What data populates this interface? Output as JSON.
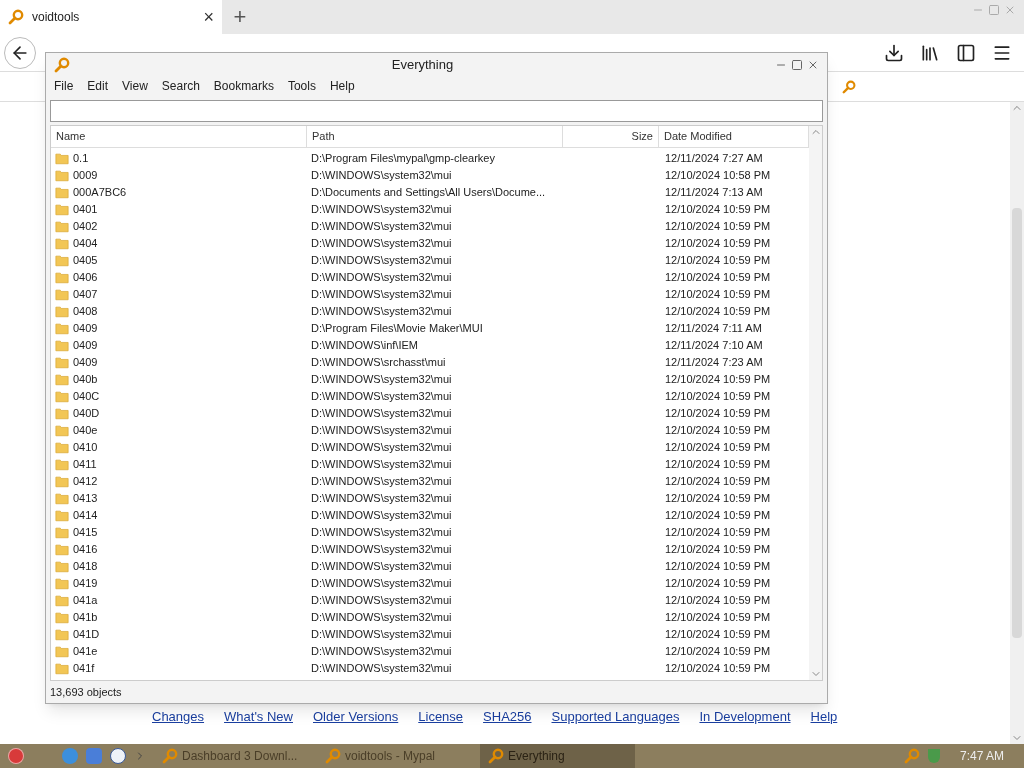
{
  "browser": {
    "tab": {
      "title": "voidtools",
      "close": "×"
    },
    "new_tab": "+"
  },
  "window": {
    "title": "Everything",
    "menu": [
      "File",
      "Edit",
      "View",
      "Search",
      "Bookmarks",
      "Tools",
      "Help"
    ],
    "table": {
      "columns": [
        "Name",
        "Path",
        "Size",
        "Date Modified"
      ],
      "rows": [
        {
          "name": "0.1",
          "path": "D:\\Program Files\\mypal\\gmp-clearkey",
          "date": "12/11/2024 7:27 AM"
        },
        {
          "name": "0009",
          "path": "D:\\WINDOWS\\system32\\mui",
          "date": "12/10/2024 10:58 PM"
        },
        {
          "name": "000A7BC6",
          "path": "D:\\Documents and Settings\\All Users\\Docume...",
          "date": "12/11/2024 7:13 AM"
        },
        {
          "name": "0401",
          "path": "D:\\WINDOWS\\system32\\mui",
          "date": "12/10/2024 10:59 PM"
        },
        {
          "name": "0402",
          "path": "D:\\WINDOWS\\system32\\mui",
          "date": "12/10/2024 10:59 PM"
        },
        {
          "name": "0404",
          "path": "D:\\WINDOWS\\system32\\mui",
          "date": "12/10/2024 10:59 PM"
        },
        {
          "name": "0405",
          "path": "D:\\WINDOWS\\system32\\mui",
          "date": "12/10/2024 10:59 PM"
        },
        {
          "name": "0406",
          "path": "D:\\WINDOWS\\system32\\mui",
          "date": "12/10/2024 10:59 PM"
        },
        {
          "name": "0407",
          "path": "D:\\WINDOWS\\system32\\mui",
          "date": "12/10/2024 10:59 PM"
        },
        {
          "name": "0408",
          "path": "D:\\WINDOWS\\system32\\mui",
          "date": "12/10/2024 10:59 PM"
        },
        {
          "name": "0409",
          "path": "D:\\Program Files\\Movie Maker\\MUI",
          "date": "12/11/2024 7:11 AM"
        },
        {
          "name": "0409",
          "path": "D:\\WINDOWS\\inf\\IEM",
          "date": "12/11/2024 7:10 AM"
        },
        {
          "name": "0409",
          "path": "D:\\WINDOWS\\srchasst\\mui",
          "date": "12/11/2024 7:23 AM"
        },
        {
          "name": "040b",
          "path": "D:\\WINDOWS\\system32\\mui",
          "date": "12/10/2024 10:59 PM"
        },
        {
          "name": "040C",
          "path": "D:\\WINDOWS\\system32\\mui",
          "date": "12/10/2024 10:59 PM"
        },
        {
          "name": "040D",
          "path": "D:\\WINDOWS\\system32\\mui",
          "date": "12/10/2024 10:59 PM"
        },
        {
          "name": "040e",
          "path": "D:\\WINDOWS\\system32\\mui",
          "date": "12/10/2024 10:59 PM"
        },
        {
          "name": "0410",
          "path": "D:\\WINDOWS\\system32\\mui",
          "date": "12/10/2024 10:59 PM"
        },
        {
          "name": "0411",
          "path": "D:\\WINDOWS\\system32\\mui",
          "date": "12/10/2024 10:59 PM"
        },
        {
          "name": "0412",
          "path": "D:\\WINDOWS\\system32\\mui",
          "date": "12/10/2024 10:59 PM"
        },
        {
          "name": "0413",
          "path": "D:\\WINDOWS\\system32\\mui",
          "date": "12/10/2024 10:59 PM"
        },
        {
          "name": "0414",
          "path": "D:\\WINDOWS\\system32\\mui",
          "date": "12/10/2024 10:59 PM"
        },
        {
          "name": "0415",
          "path": "D:\\WINDOWS\\system32\\mui",
          "date": "12/10/2024 10:59 PM"
        },
        {
          "name": "0416",
          "path": "D:\\WINDOWS\\system32\\mui",
          "date": "12/10/2024 10:59 PM"
        },
        {
          "name": "0418",
          "path": "D:\\WINDOWS\\system32\\mui",
          "date": "12/10/2024 10:59 PM"
        },
        {
          "name": "0419",
          "path": "D:\\WINDOWS\\system32\\mui",
          "date": "12/10/2024 10:59 PM"
        },
        {
          "name": "041a",
          "path": "D:\\WINDOWS\\system32\\mui",
          "date": "12/10/2024 10:59 PM"
        },
        {
          "name": "041b",
          "path": "D:\\WINDOWS\\system32\\mui",
          "date": "12/10/2024 10:59 PM"
        },
        {
          "name": "041D",
          "path": "D:\\WINDOWS\\system32\\mui",
          "date": "12/10/2024 10:59 PM"
        },
        {
          "name": "041e",
          "path": "D:\\WINDOWS\\system32\\mui",
          "date": "12/10/2024 10:59 PM"
        },
        {
          "name": "041f",
          "path": "D:\\WINDOWS\\system32\\mui",
          "date": "12/10/2024 10:59 PM"
        }
      ]
    },
    "status": "13,693 objects"
  },
  "footer_links": [
    "Changes",
    "What's New",
    "Older Versions",
    "License",
    "SHA256",
    "Supported Languages",
    "In Development",
    "Help"
  ],
  "taskbar": {
    "items": [
      {
        "label": "Dashboard 3 Downl...",
        "selected": false
      },
      {
        "label": "voidtools - Mypal",
        "selected": false
      },
      {
        "label": "Everything",
        "selected": true
      }
    ],
    "clock": "7:47 AM"
  }
}
